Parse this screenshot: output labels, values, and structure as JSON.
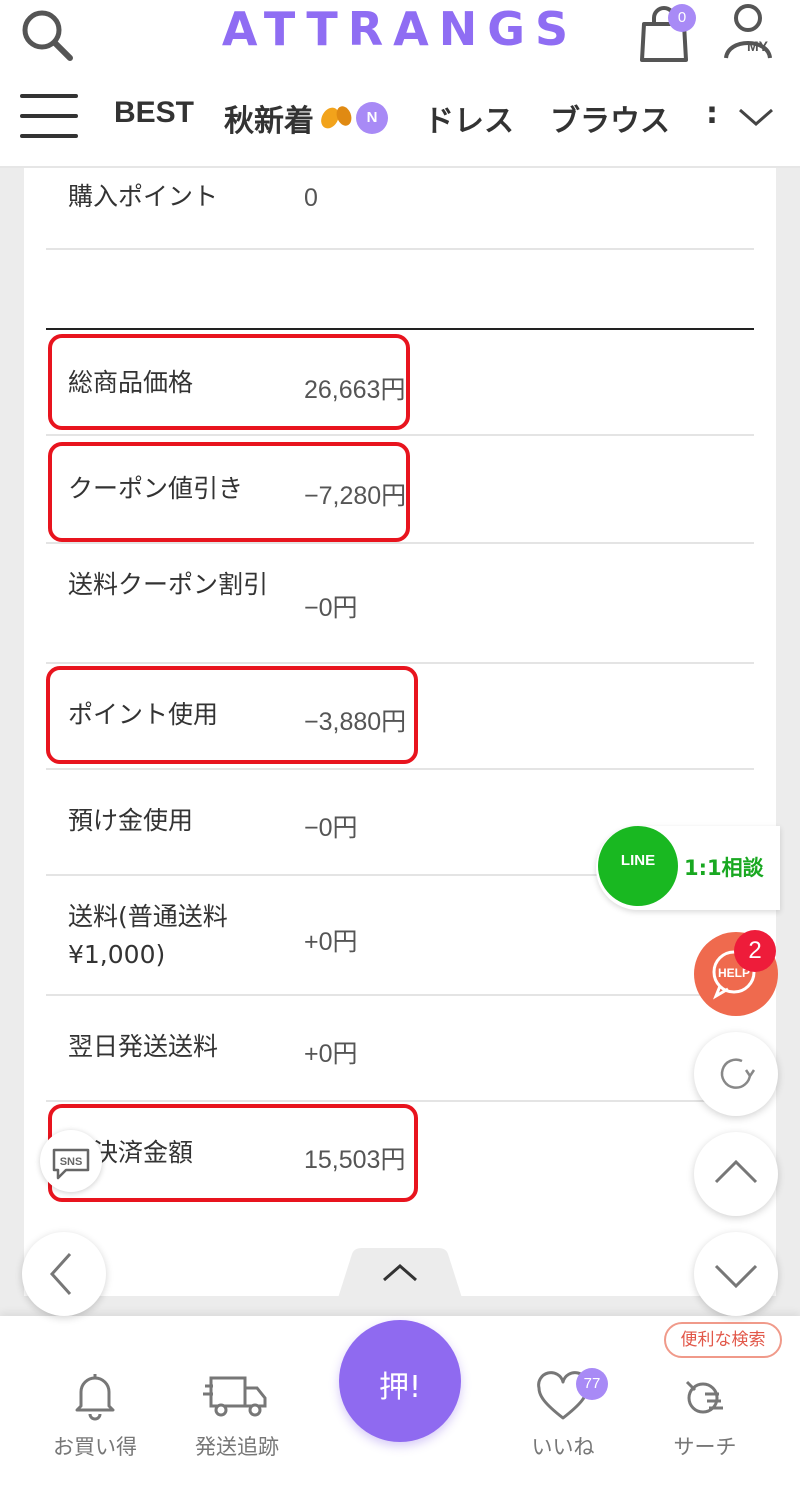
{
  "header": {
    "logo": "ATTRANGS",
    "cart_count": "0",
    "my_label": "MY"
  },
  "nav": {
    "items": [
      {
        "label": "BEST"
      },
      {
        "label": "秋新着"
      },
      {
        "label": "ドレス"
      },
      {
        "label": "ブラウス"
      },
      {
        "label": ":"
      }
    ],
    "new_badge": "N"
  },
  "summary": {
    "purchase_points": {
      "label": "購入ポイント",
      "value": "0"
    },
    "rows": [
      {
        "label": "総商品価格",
        "value": "26,663円"
      },
      {
        "label": "クーポン値引き",
        "value": "−7,280円"
      },
      {
        "label": "送料クーポン割引",
        "value": "−0円"
      },
      {
        "label": "ポイント使用",
        "value": "−3,880円"
      },
      {
        "label": "預け金使用",
        "value": "−0円"
      },
      {
        "label": "送料(普通送料¥1,000)",
        "value": "+0円"
      },
      {
        "label": "翌日発送送料",
        "value": "+0円"
      },
      {
        "label": "総決済金額",
        "value": "15,503円"
      }
    ]
  },
  "floating": {
    "line_label": "LINE",
    "line_consult": "1:1相談",
    "help_label": "HELP",
    "help_count": "2",
    "sns_label": "SNS"
  },
  "bottom_nav": {
    "items": [
      {
        "label": "お買い得"
      },
      {
        "label": "発送追跡"
      },
      {
        "label": "いいね"
      },
      {
        "label": "サーチ"
      }
    ],
    "push_label": "押!",
    "like_count": "77",
    "search_tip": "便利な検索"
  },
  "colors": {
    "brand": "#8f6df3",
    "highlight": "#e8141e",
    "line_green": "#19b821",
    "help_orange": "#ef6a4e"
  }
}
